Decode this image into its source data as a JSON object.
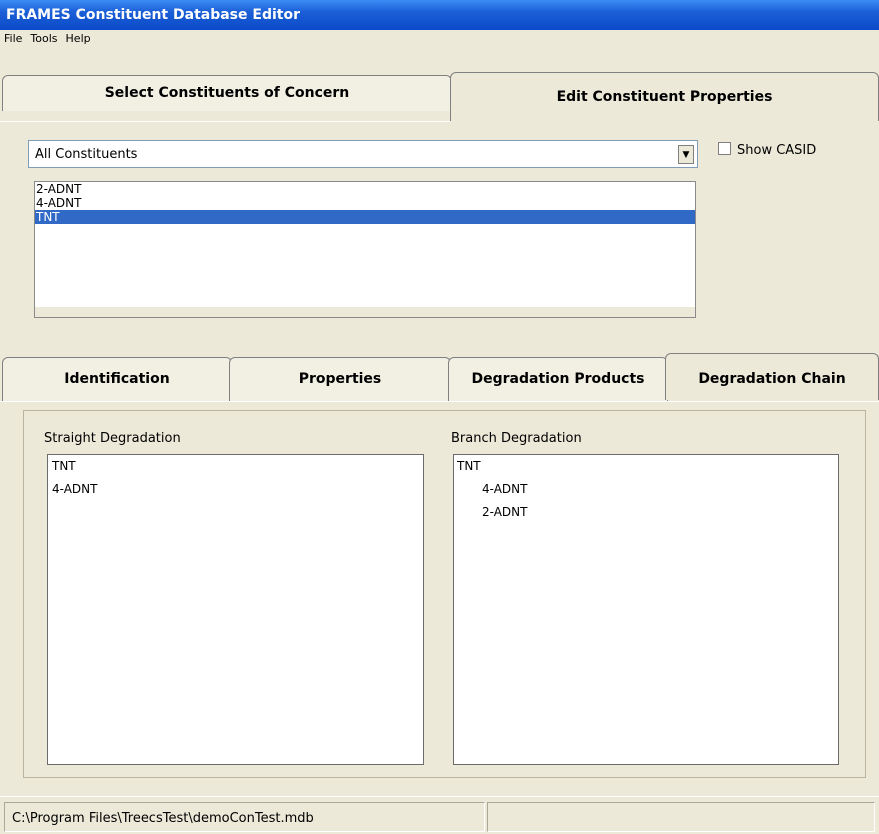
{
  "window": {
    "title": "FRAMES Constituent Database Editor"
  },
  "menu": [
    "File",
    "Tools",
    "Help"
  ],
  "top_tabs": [
    {
      "label": "Select Constituents of Concern",
      "active": false
    },
    {
      "label": "Edit Constituent Properties",
      "active": true
    }
  ],
  "filter": {
    "value": "All Constituents",
    "dropdown_icon": "chevron-down-icon"
  },
  "show_casid": {
    "label": "Show CASID",
    "checked": false
  },
  "constituents": [
    "2-ADNT",
    "4-ADNT",
    "TNT"
  ],
  "selected_constituent": "TNT",
  "bottom_tabs": [
    {
      "label": "Identification",
      "active": false
    },
    {
      "label": "Properties",
      "active": false
    },
    {
      "label": "Degradation Products",
      "active": false
    },
    {
      "label": "Degradation Chain",
      "active": true
    }
  ],
  "straight": {
    "label": "Straight Degradation",
    "items": [
      "TNT",
      "4-ADNT"
    ]
  },
  "branch": {
    "label": "Branch Degradation",
    "root": "TNT",
    "children": [
      "4-ADNT",
      "2-ADNT"
    ]
  },
  "status": {
    "path": "C:\\Program Files\\TreecsTest\\demoConTest.mdb",
    "right": ""
  },
  "colors": {
    "title_bar": "#0b4ac9",
    "selection": "#3169c6",
    "face": "#ece9d8"
  }
}
